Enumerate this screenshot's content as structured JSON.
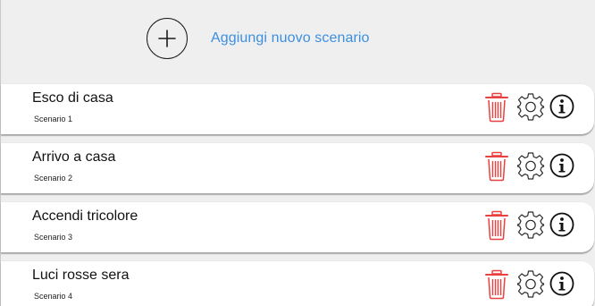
{
  "header": {
    "add_label": "Aggiungi nuovo scenario"
  },
  "colors": {
    "accent": "#3d8fe0",
    "delete": "#e8413f",
    "background": "#efefef"
  },
  "icons": {
    "add": "plus-circle-icon",
    "delete": "trash-icon",
    "settings": "gear-icon",
    "info": "info-icon"
  },
  "scenarios": [
    {
      "title": "Esco di casa",
      "subtitle": "Scenario 1"
    },
    {
      "title": "Arrivo a casa",
      "subtitle": "Scenario 2"
    },
    {
      "title": "Accendi tricolore",
      "subtitle": "Scenario 3"
    },
    {
      "title": "Luci rosse sera",
      "subtitle": "Scenario 4"
    }
  ]
}
